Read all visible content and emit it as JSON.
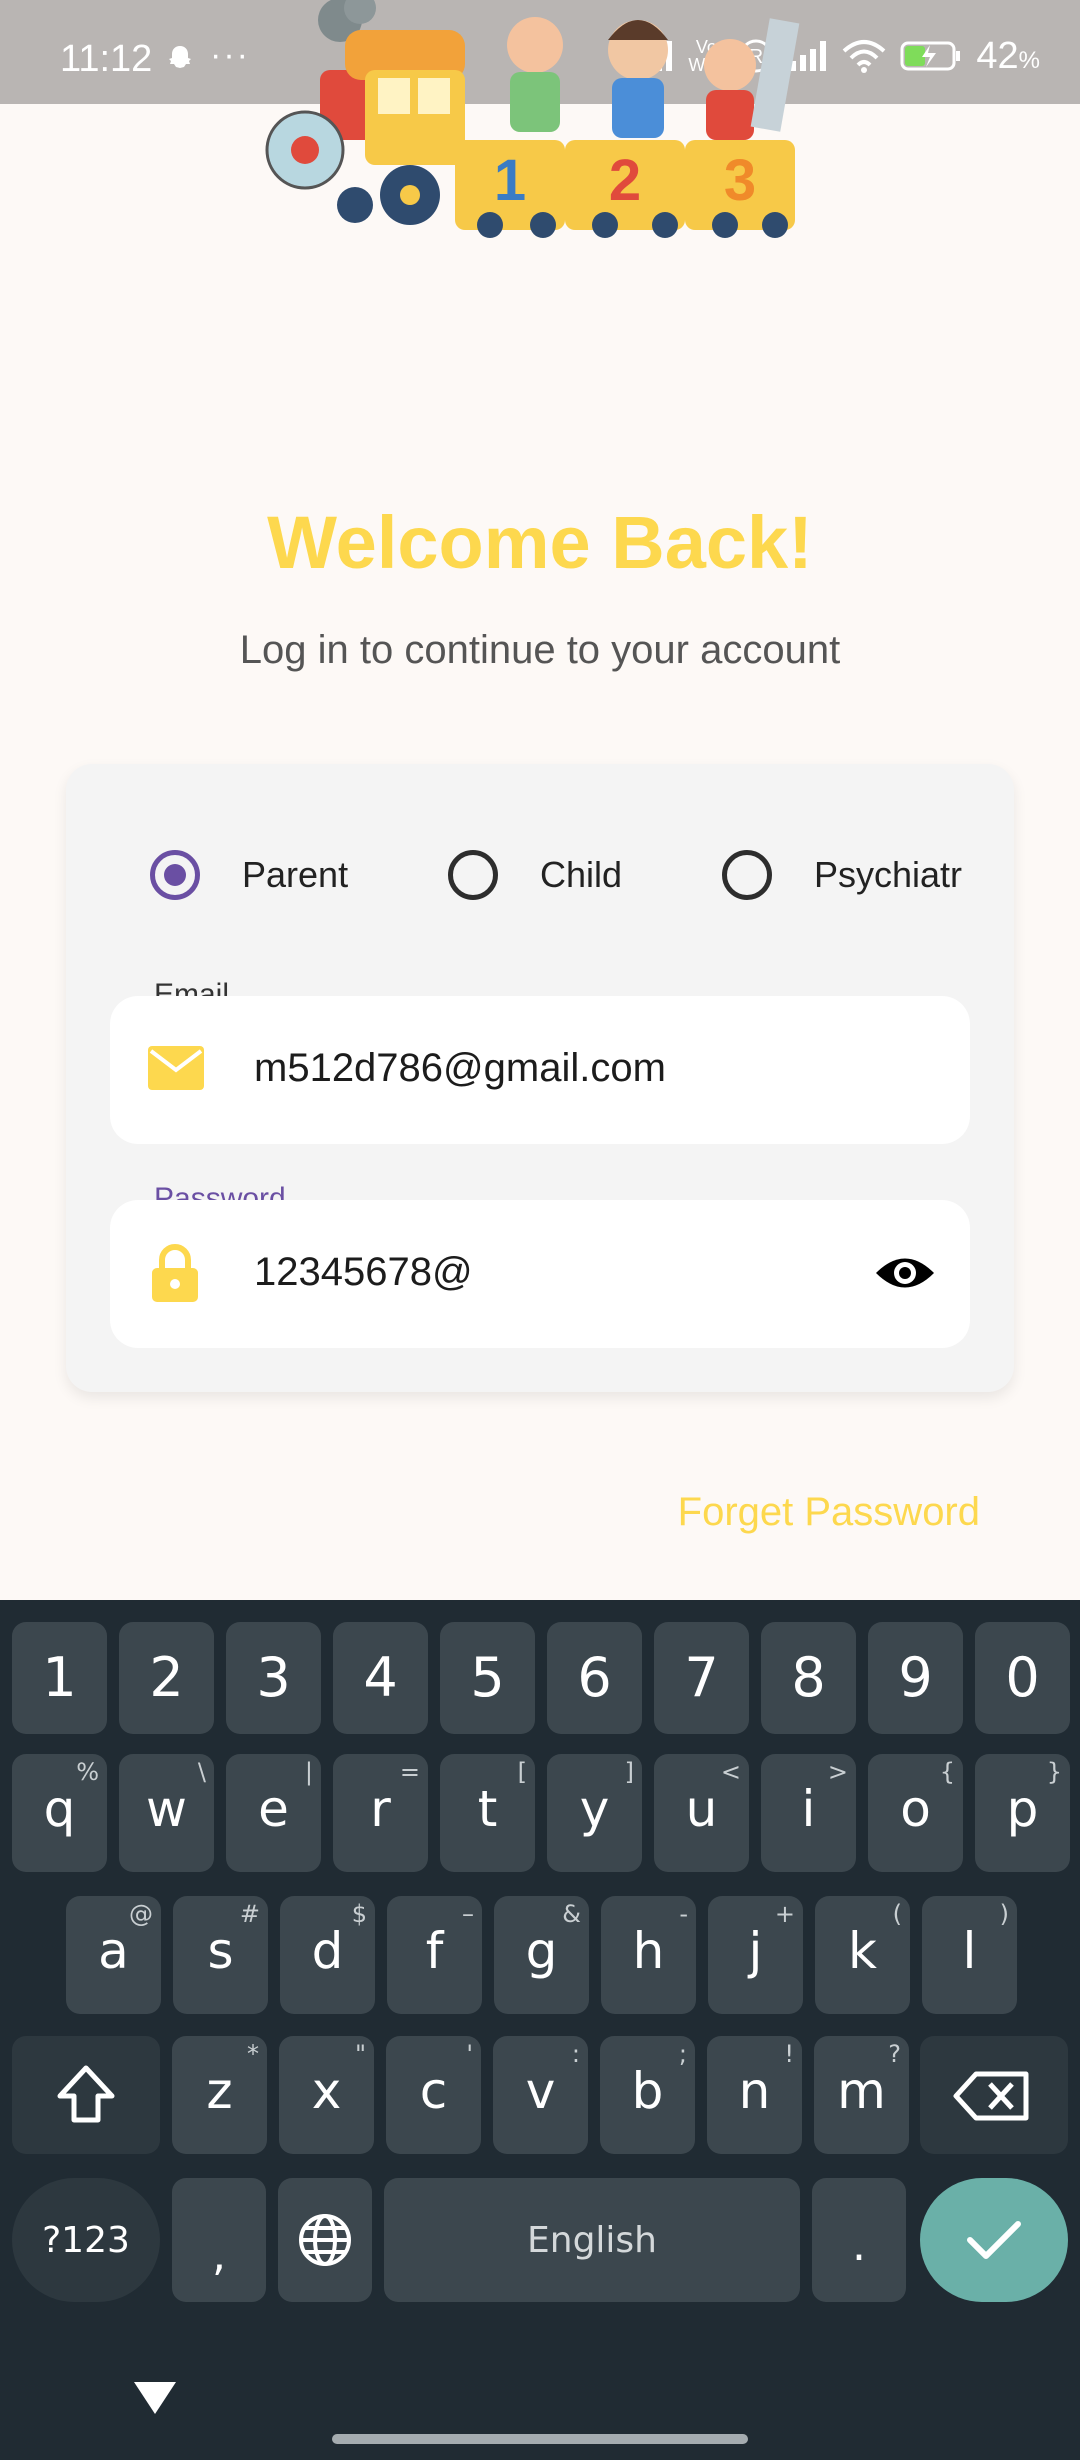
{
  "status_bar": {
    "time": "11:12",
    "dots": "···",
    "vo_wifi_top": "Vo",
    "vo_wifi_bottom": "WiFi",
    "battery_level": "42",
    "battery_unit": "%"
  },
  "header": {
    "title": "Welcome Back!",
    "subtitle": "Log in to continue to your account"
  },
  "roles": {
    "options": [
      "Parent",
      "Child",
      "Psychiatr"
    ],
    "selected": "Parent"
  },
  "email": {
    "label": "Email",
    "value": "m512d786@gmail.com"
  },
  "password": {
    "label": "Password",
    "value": "12345678@"
  },
  "forget_password": "Forget Password",
  "keyboard": {
    "numbers": [
      "1",
      "2",
      "3",
      "4",
      "5",
      "6",
      "7",
      "8",
      "9",
      "0"
    ],
    "row1": [
      {
        "k": "q",
        "a": "%"
      },
      {
        "k": "w",
        "a": "\\"
      },
      {
        "k": "e",
        "a": "|"
      },
      {
        "k": "r",
        "a": "="
      },
      {
        "k": "t",
        "a": "["
      },
      {
        "k": "y",
        "a": "]"
      },
      {
        "k": "u",
        "a": "<"
      },
      {
        "k": "i",
        "a": ">"
      },
      {
        "k": "o",
        "a": "{"
      },
      {
        "k": "p",
        "a": "}"
      }
    ],
    "row2": [
      {
        "k": "a",
        "a": "@"
      },
      {
        "k": "s",
        "a": "#"
      },
      {
        "k": "d",
        "a": "$"
      },
      {
        "k": "f",
        "a": "–"
      },
      {
        "k": "g",
        "a": "&"
      },
      {
        "k": "h",
        "a": "-"
      },
      {
        "k": "j",
        "a": "+"
      },
      {
        "k": "k",
        "a": "("
      },
      {
        "k": "l",
        "a": ")"
      }
    ],
    "row3": [
      {
        "k": "z",
        "a": "*"
      },
      {
        "k": "x",
        "a": "\""
      },
      {
        "k": "c",
        "a": "'"
      },
      {
        "k": "v",
        "a": ":"
      },
      {
        "k": "b",
        "a": ";"
      },
      {
        "k": "n",
        "a": "!"
      },
      {
        "k": "m",
        "a": "?"
      }
    ],
    "symbols_key": "?123",
    "comma_key": ",",
    "space_key": "English",
    "period_key": "."
  },
  "colors": {
    "accent_yellow": "#fdd84e",
    "radio_selected": "#6a4fa3",
    "enter_key": "#6ab0a8"
  }
}
